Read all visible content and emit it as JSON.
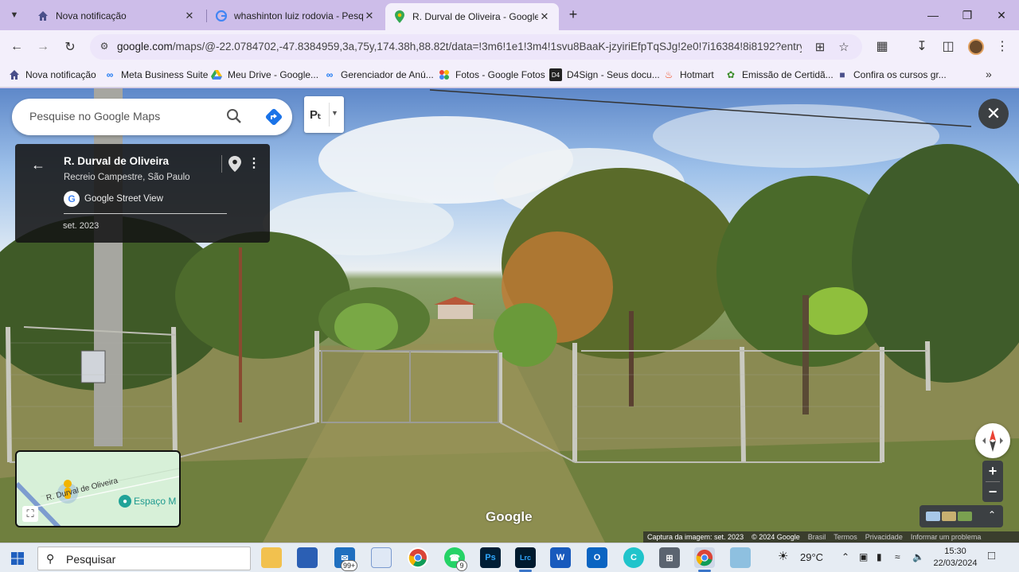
{
  "browser": {
    "tabs": [
      {
        "title": "Nova notificação",
        "icon": "home-icon",
        "active": false
      },
      {
        "title": "whashinton luiz rodovia - Pesquisa",
        "icon": "google-g-icon",
        "active": false
      },
      {
        "title": "R. Durval de Oliveira - Google Maps",
        "icon": "maps-pin-icon",
        "active": true
      }
    ],
    "new_tab": "+",
    "url_host": "google.com",
    "url_rest": "/maps/@-22.0784702,-47.8384959,3a,75y,174.38h,88.82t/data=!3m6!1e1!3m4!1svu8BaaK-jzyiriEfpTqSJg!2e0!7i16384!8i8192?entry=ttu",
    "bookmarks": [
      {
        "label": "Nova notificação",
        "icon": "home-icon"
      },
      {
        "label": "Meta Business Suite",
        "icon": "meta-icon"
      },
      {
        "label": "Meu Drive - Google...",
        "icon": "drive-icon"
      },
      {
        "label": "Gerenciador de Anú...",
        "icon": "meta-icon"
      },
      {
        "label": "Fotos - Google Fotos",
        "icon": "photos-icon"
      },
      {
        "label": "D4Sign - Seus docu...",
        "icon": "d4sign-icon"
      },
      {
        "label": "Hotmart",
        "icon": "hotmart-icon"
      },
      {
        "label": "Emissão de Certidã...",
        "icon": "certidao-icon"
      },
      {
        "label": "Confira os cursos gr...",
        "icon": "course-icon"
      }
    ]
  },
  "maps": {
    "search_placeholder": "Pesquise no Google Maps",
    "layer_label": "Pₜ",
    "info": {
      "street": "R. Durval de Oliveira",
      "area": "Recreio Campestre, São Paulo",
      "source": "Google Street View",
      "date": "set. 2023"
    },
    "minimap": {
      "street_label": "R. Durval de Oliveira",
      "poi_label": "Espaço M"
    },
    "watermark": "Google",
    "attribution": {
      "capture": "Captura da imagem: set. 2023",
      "copyright": "© 2024 Google",
      "links": [
        "Brasil",
        "Termos",
        "Privacidade",
        "Informar um problema"
      ]
    }
  },
  "taskbar": {
    "search_text": "Pesquisar",
    "mail_badge": "99+",
    "whatsapp_badge": "9",
    "weather": "29°C",
    "time": "15:30",
    "date": "22/03/2024",
    "apps": [
      {
        "name": "file-explorer-icon",
        "label": ""
      },
      {
        "name": "store-icon",
        "label": ""
      },
      {
        "name": "mail-icon",
        "label": ""
      },
      {
        "name": "app-window-icon",
        "label": ""
      },
      {
        "name": "chrome-icon",
        "label": ""
      },
      {
        "name": "whatsapp-icon",
        "label": ""
      },
      {
        "name": "photoshop-icon",
        "label": "Ps"
      },
      {
        "name": "lightroom-icon",
        "label": "Lrc"
      },
      {
        "name": "word-icon",
        "label": "W"
      },
      {
        "name": "outlook-icon",
        "label": "O"
      },
      {
        "name": "canva-icon",
        "label": "C"
      },
      {
        "name": "calculator-icon",
        "label": ""
      },
      {
        "name": "chrome-profile-icon",
        "label": ""
      },
      {
        "name": "notes-icon",
        "label": ""
      }
    ]
  },
  "colors": {
    "tab_strip": "#cdbde9",
    "toolbar": "#f3effb",
    "maps_dark": "#3c4043",
    "accent_blue": "#4285f4"
  }
}
